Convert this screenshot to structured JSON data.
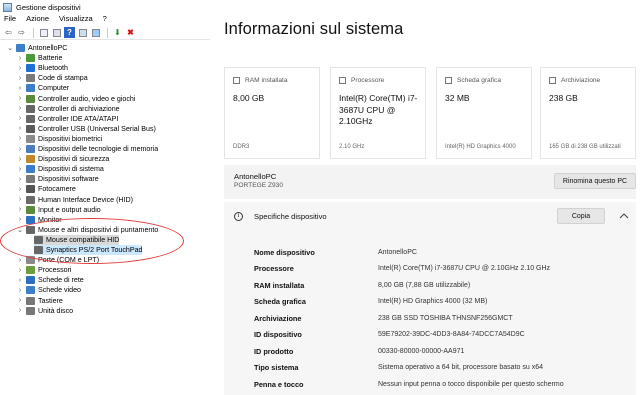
{
  "dm": {
    "title": "Gestione dispositivi",
    "menu": [
      "File",
      "Azione",
      "Visualizza",
      "?"
    ],
    "root": "AntonelloPC",
    "categories": [
      "Batterie",
      "Bluetooth",
      "Code di stampa",
      "Computer",
      "Controller audio, video e giochi",
      "Controller di archiviazione",
      "Controller IDE ATA/ATAPI",
      "Controller USB (Universal Serial Bus)",
      "Dispositivi biometrici",
      "Dispositivi delle tecnologie di memoria",
      "Dispositivi di sicurezza",
      "Dispositivi di sistema",
      "Dispositivi software",
      "Fotocamere",
      "Human Interface Device (HID)",
      "Input e output audio",
      "Monitor",
      "Mouse e altri dispositivi di puntamento",
      "Porte (COM e LPT)",
      "Processori",
      "Schede di rete",
      "Schede video",
      "Tastiere",
      "Unità disco"
    ],
    "mouse_children": [
      "Mouse compatibile HID",
      "Synaptics PS/2 Port TouchPad"
    ]
  },
  "settings": {
    "title": "Informazioni sul sistema",
    "cards": [
      {
        "label": "RAM installata",
        "value": "8,00 GB",
        "foot": "DDR3",
        "icon": "memory-icon"
      },
      {
        "label": "Processore",
        "value": "Intel(R) Core(TM) i7-3687U CPU @ 2.10GHz",
        "foot": "2.10 GHz",
        "icon": "cpu-icon"
      },
      {
        "label": "Scheda grafica",
        "value": "32 MB",
        "foot": "Intel(R) HD Graphics 4000",
        "icon": "gpu-icon"
      },
      {
        "label": "Archiviazione",
        "value": "238 GB",
        "foot": "165 GB di 238 GB utilizzati",
        "icon": "storage-icon"
      }
    ],
    "pc_name": "AntonelloPC",
    "pc_model": "PORTEGE Z930",
    "rename_label": "Rinomina questo PC",
    "specs_title": "Specifiche dispositivo",
    "copy_label": "Copia",
    "specs": [
      {
        "k": "Nome dispositivo",
        "v": "AntonelloPC"
      },
      {
        "k": "Processore",
        "v": "Intel(R) Core(TM) i7-3687U CPU @ 2.10GHz   2.10 GHz"
      },
      {
        "k": "RAM installata",
        "v": "8,00 GB (7,88 GB utilizzabile)"
      },
      {
        "k": "Scheda grafica",
        "v": "Intel(R) HD Graphics 4000 (32 MB)"
      },
      {
        "k": "Archiviazione",
        "v": "238 GB SSD TOSHIBA THNSNF256GMCT"
      },
      {
        "k": "ID dispositivo",
        "v": "59E79202-39DC-4DD3-8A84-74DCC7A54D9C"
      },
      {
        "k": "ID prodotto",
        "v": "00330-80000-00000-AA971"
      },
      {
        "k": "Tipo sistema",
        "v": "Sistema operativo a 64 bit, processore basato su x64"
      },
      {
        "k": "Penna e tocco",
        "v": "Nessun input penna o tocco disponibile per questo schermo"
      }
    ]
  },
  "colors": {
    "selection": "#cce8ff",
    "annotation": "#e23a3a"
  }
}
